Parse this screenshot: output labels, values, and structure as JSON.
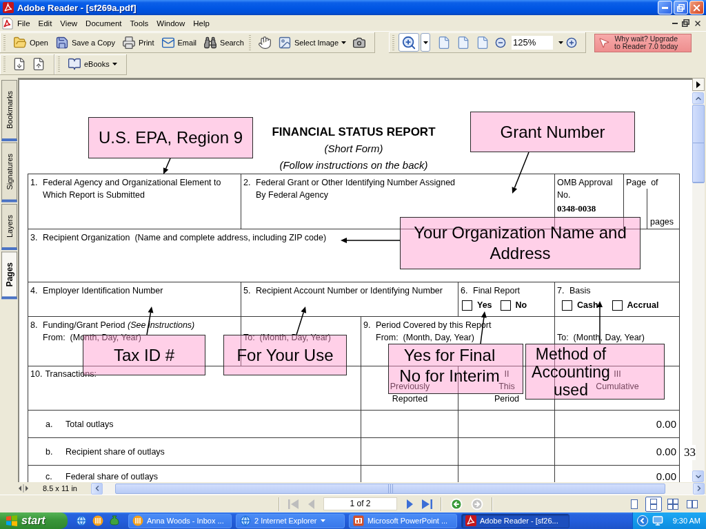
{
  "window": {
    "title": "Adobe Reader - [sf269a.pdf]"
  },
  "menu": [
    "File",
    "Edit",
    "View",
    "Document",
    "Tools",
    "Window",
    "Help"
  ],
  "toolbar": {
    "file_tools": [
      "Open",
      "Save a Copy",
      "Print",
      "Email",
      "Search"
    ],
    "select_tool": "Select Image",
    "zoom_tool": {
      "selected": true
    },
    "zoom": "125%",
    "upgrade": "Why wait? Upgrade\nto Reader 7.0 today"
  },
  "toolbar_2": {
    "ebooks": "eBooks"
  },
  "side_tabs": [
    {
      "label": "Bookmarks",
      "selected": false
    },
    {
      "label": "Signatures",
      "selected": false
    },
    {
      "label": "Layers",
      "selected": false
    },
    {
      "label": "Pages",
      "selected": true
    }
  ],
  "form": {
    "title": "FINANCIAL STATUS REPORT",
    "subtitle": "(Short Form)",
    "note": "(Follow instructions on the back)",
    "agency": {
      "number": "1.",
      "label": "Federal Agency and Organizational Element to Which Report is Submitted"
    },
    "grant": {
      "number": "2.",
      "label": "Federal Grant or Other Identifying Number Assigned By Federal Agency"
    },
    "omb": {
      "label": "OMB Approval No.",
      "value": "0348-0038"
    },
    "pages": {
      "label": "Page  of",
      "unit": "pages"
    },
    "recipient": {
      "number": "3.",
      "label": "Recipient Organization  (Name and complete address, including ZIP code)"
    },
    "employer_id": {
      "number": "4.",
      "label": "Employer Identification Number"
    },
    "account": {
      "number": "5.",
      "label": "Recipient Account Number or Identifying Number"
    },
    "final_report": {
      "number": "6.",
      "label": "Final Report",
      "options": [
        {
          "label": "Yes",
          "checked": false
        },
        {
          "label": "No",
          "checked": false
        }
      ]
    },
    "basis": {
      "number": "7.",
      "label": "Basis",
      "options": [
        {
          "label": "Cash",
          "checked": false
        },
        {
          "label": "Accrual",
          "checked": false
        }
      ]
    },
    "funding_period": {
      "number": "8.",
      "label": "Funding/Grant Period *(See instructions)*",
      "from": "From:  (Month, Day, Year)",
      "to": "To:  (Month, Day, Year)"
    },
    "report_period": {
      "number": "9.",
      "label": "Period Covered by this Report",
      "from": "From:  (Month, Day, Year)",
      "to": "To:  (Month, Day, Year)"
    },
    "transactions": {
      "number": "10.",
      "label": "Transactions:",
      "columns": [
        {
          "label": "Previously Reported"
        },
        {
          "numeral": "II",
          "label": "This Period"
        },
        {
          "numeral": "III",
          "label": "Cumulative"
        }
      ],
      "rows": [
        {
          "letter": "a.",
          "label": "Total outlays",
          "cumulative": "0.00"
        },
        {
          "letter": "b.",
          "label": "Recipient share of outlays",
          "cumulative": "0.00"
        },
        {
          "letter": "c.",
          "label": "Federal share of outlays",
          "cumulative": "0.00"
        }
      ]
    }
  },
  "callouts": [
    {
      "text": "U.S. EPA, Region 9"
    },
    {
      "text": "Grant Number"
    },
    {
      "text": "Your Organization Name and Address"
    },
    {
      "text": "Tax ID #"
    },
    {
      "text": "For Your Use"
    },
    {
      "text": "Yes for Final No for Interim"
    },
    {
      "text": "Method of Accounting used"
    }
  ],
  "slide_number": "33",
  "page_size": "8.5 x 11 in",
  "navigation": {
    "page": "1 of 2",
    "nav_buttons": [
      {
        "disabled": true
      },
      {
        "disabled": true
      },
      {
        "disabled": false
      },
      {
        "disabled": false
      }
    ],
    "history_buttons": [
      {
        "disabled": false
      },
      {
        "disabled": true
      }
    ],
    "view_modes": [
      {
        "selected": false
      },
      {
        "selected": true
      },
      {
        "selected": false
      },
      {
        "selected": false
      }
    ]
  },
  "taskbar": {
    "start": "start",
    "tasks": [
      {
        "label": "Anna Woods - Inbox ...",
        "kind": "window",
        "selected": false
      },
      {
        "label": "2 Internet Explorer",
        "kind": "group",
        "selected": false
      },
      {
        "label": "Microsoft PowerPoint ...",
        "kind": "window",
        "selected": false
      },
      {
        "label": "Adobe Reader - [sf26...",
        "kind": "window",
        "selected": true
      }
    ],
    "clock": "9:30 AM"
  }
}
